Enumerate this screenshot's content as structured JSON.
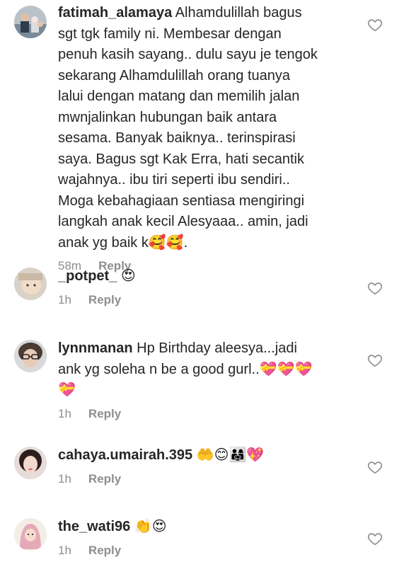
{
  "comments": [
    {
      "username": "fatimah_alamaya",
      "text": "Alhamdulillah bagus\nsgt tgk family ni. Membesar dengan\npenuh kasih sayang.. dulu sayu je tengok\nsekarang Alhamdulillah orang tuanya\nlalui dengan matang dan memilih jalan\nmwnjalinkan hubungan baik antara\nsesama. Banyak baiknya.. terinspirasi\nsaya. Bagus sgt Kak Erra, hati secantik\nwajahnya.. ibu tiri seperti ibu sendiri..\nMoga kebahagiaan sentiasa mengiringi\nlangkah anak kecil Alesyaaa.. amin, jadi\nanak yg baik k🥰🥰.",
      "time": "58m",
      "reply_label": "Reply",
      "avatar_icon": "family-photo-avatar"
    },
    {
      "username": "_potpet_",
      "text": "😍",
      "time": "1h",
      "reply_label": "Reply",
      "avatar_icon": "baby-photo-avatar"
    },
    {
      "username": "lynnmanan",
      "text": "Hp Birthday aleesya...jadi\nank yg soleha n be a good gurl..💝💝💝\n💝",
      "time": "1h",
      "reply_label": "Reply",
      "avatar_icon": "woman-glasses-avatar"
    },
    {
      "username": "cahaya.umairah.395",
      "text": "🤲😊👨‍👩‍👧💖",
      "time": "1h",
      "reply_label": "Reply",
      "avatar_icon": "woman-portrait-avatar"
    },
    {
      "username": "the_wati96",
      "text": "👏😍",
      "time": "1h",
      "reply_label": "Reply",
      "avatar_icon": "hijab-illustration-avatar"
    }
  ],
  "colors": {
    "text": "#262626",
    "meta": "#8e8e8e",
    "heart_stroke": "#8e8e8e"
  }
}
